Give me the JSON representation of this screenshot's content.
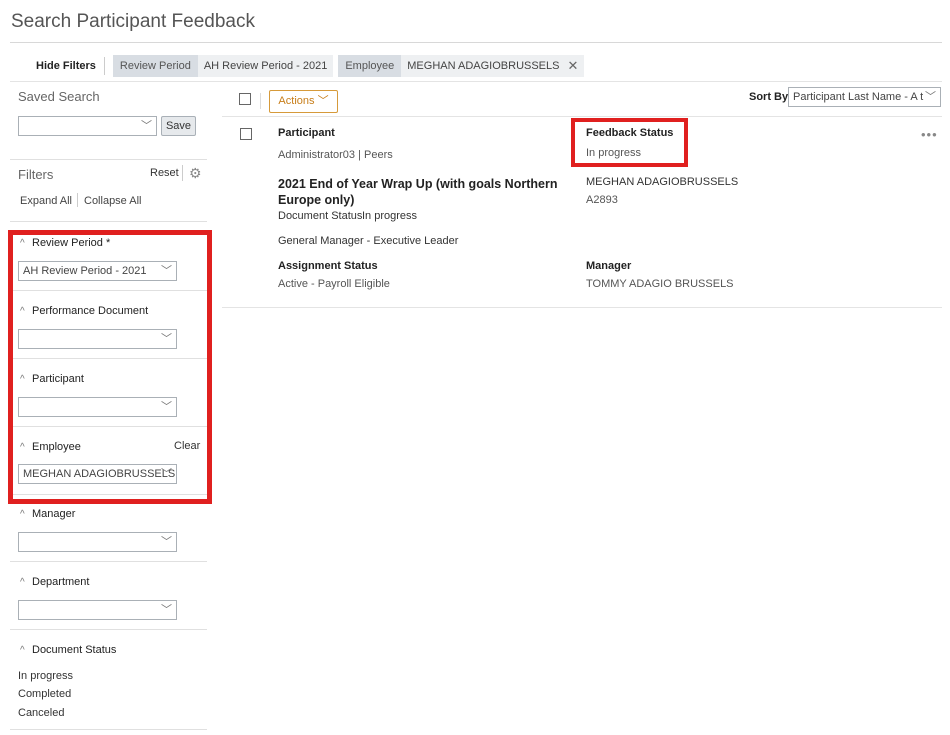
{
  "page": {
    "title": "Search Participant Feedback"
  },
  "filter_bar": {
    "hide_filters_label": "Hide Filters",
    "chips": [
      {
        "key": "Review Period",
        "value": "AH Review Period - 2021"
      },
      {
        "key": "Employee",
        "value": "MEGHAN ADAGIOBRUSSELS"
      }
    ]
  },
  "sidebar": {
    "saved_search_title": "Saved Search",
    "saved_search_value": "",
    "save_label": "Save",
    "filters_title": "Filters",
    "reset_label": "Reset",
    "expand_all": "Expand All",
    "collapse_all": "Collapse All",
    "sections": {
      "review_period": {
        "label": "Review Period *",
        "value": "AH Review Period - 2021"
      },
      "performance_document": {
        "label": "Performance Document",
        "value": ""
      },
      "participant": {
        "label": "Participant",
        "value": ""
      },
      "employee": {
        "label": "Employee",
        "value": "MEGHAN ADAGIOBRUSSELS",
        "clear_label": "Clear"
      },
      "manager": {
        "label": "Manager",
        "value": ""
      },
      "department": {
        "label": "Department",
        "value": ""
      },
      "document_status": {
        "label": "Document Status",
        "options": [
          "In progress",
          "Completed",
          "Canceled"
        ]
      }
    }
  },
  "toolbar": {
    "actions_label": "Actions",
    "sort_by_label": "Sort By",
    "sort_by_value": "Participant Last Name - A t"
  },
  "result": {
    "participant_label": "Participant",
    "participant_value": "Administrator03 | Peers",
    "feedback_status_label": "Feedback Status",
    "feedback_status_value": "In progress",
    "document_title": "2021 End of Year Wrap Up (with goals Northern Europe only)",
    "employee_name": "MEGHAN ADAGIOBRUSSELS",
    "employee_id": "A2893",
    "document_status_label": "Document Status",
    "document_status_value": "In progress",
    "job_title": "General Manager - Executive Leader",
    "assignment_status_label": "Assignment Status",
    "assignment_status_value": "Active - Payroll Eligible",
    "manager_label": "Manager",
    "manager_value": "TOMMY ADAGIO BRUSSELS"
  },
  "colors": {
    "highlight": "#e0201f",
    "actions_accent": "#c77d18"
  },
  "icons": {
    "dropdown": "chevron-down-icon",
    "settings": "gear-icon",
    "more": "more-icon",
    "remove": "close-icon",
    "collapse": "caret-up-icon"
  }
}
